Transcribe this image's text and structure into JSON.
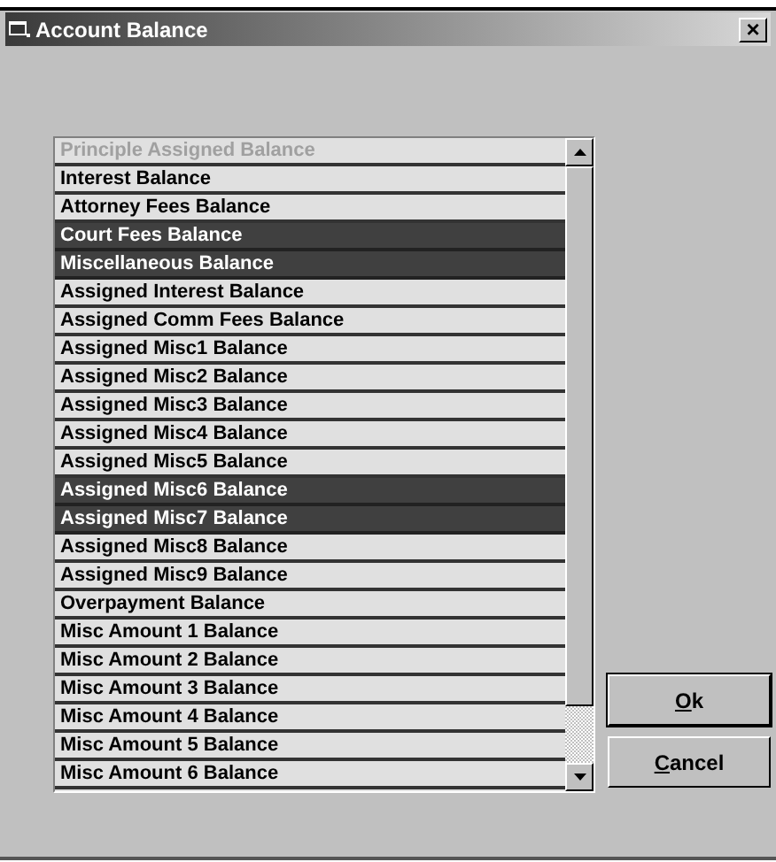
{
  "window": {
    "title": "Account Balance",
    "close": "×"
  },
  "list": {
    "items": [
      {
        "label": "Principle Assigned Balance",
        "selected": false,
        "disabled": true
      },
      {
        "label": "Interest Balance",
        "selected": false,
        "disabled": false
      },
      {
        "label": "Attorney Fees Balance",
        "selected": false,
        "disabled": false
      },
      {
        "label": "Court Fees Balance",
        "selected": true,
        "disabled": false
      },
      {
        "label": "Miscellaneous Balance",
        "selected": true,
        "disabled": false
      },
      {
        "label": "Assigned Interest Balance",
        "selected": false,
        "disabled": false
      },
      {
        "label": "Assigned Comm Fees Balance",
        "selected": false,
        "disabled": false
      },
      {
        "label": "Assigned Misc1 Balance",
        "selected": false,
        "disabled": false
      },
      {
        "label": "Assigned Misc2 Balance",
        "selected": false,
        "disabled": false
      },
      {
        "label": "Assigned Misc3 Balance",
        "selected": false,
        "disabled": false
      },
      {
        "label": "Assigned Misc4 Balance",
        "selected": false,
        "disabled": false
      },
      {
        "label": "Assigned Misc5 Balance",
        "selected": false,
        "disabled": false
      },
      {
        "label": "Assigned Misc6 Balance",
        "selected": true,
        "disabled": false
      },
      {
        "label": "Assigned Misc7 Balance",
        "selected": true,
        "disabled": false
      },
      {
        "label": "Assigned Misc8 Balance",
        "selected": false,
        "disabled": false
      },
      {
        "label": "Assigned Misc9 Balance",
        "selected": false,
        "disabled": false
      },
      {
        "label": "Overpayment Balance",
        "selected": false,
        "disabled": false
      },
      {
        "label": "Misc Amount 1 Balance",
        "selected": false,
        "disabled": false
      },
      {
        "label": "Misc Amount 2 Balance",
        "selected": false,
        "disabled": false
      },
      {
        "label": "Misc Amount 3 Balance",
        "selected": false,
        "disabled": false
      },
      {
        "label": "Misc Amount 4 Balance",
        "selected": false,
        "disabled": false
      },
      {
        "label": "Misc Amount 5 Balance",
        "selected": false,
        "disabled": false
      },
      {
        "label": "Misc Amount 6 Balance",
        "selected": false,
        "disabled": false
      }
    ]
  },
  "buttons": [
    {
      "accel_key": "O",
      "label_rest": "k",
      "default": true
    },
    {
      "accel_key": "C",
      "label_rest": "ancel",
      "default": false
    }
  ]
}
